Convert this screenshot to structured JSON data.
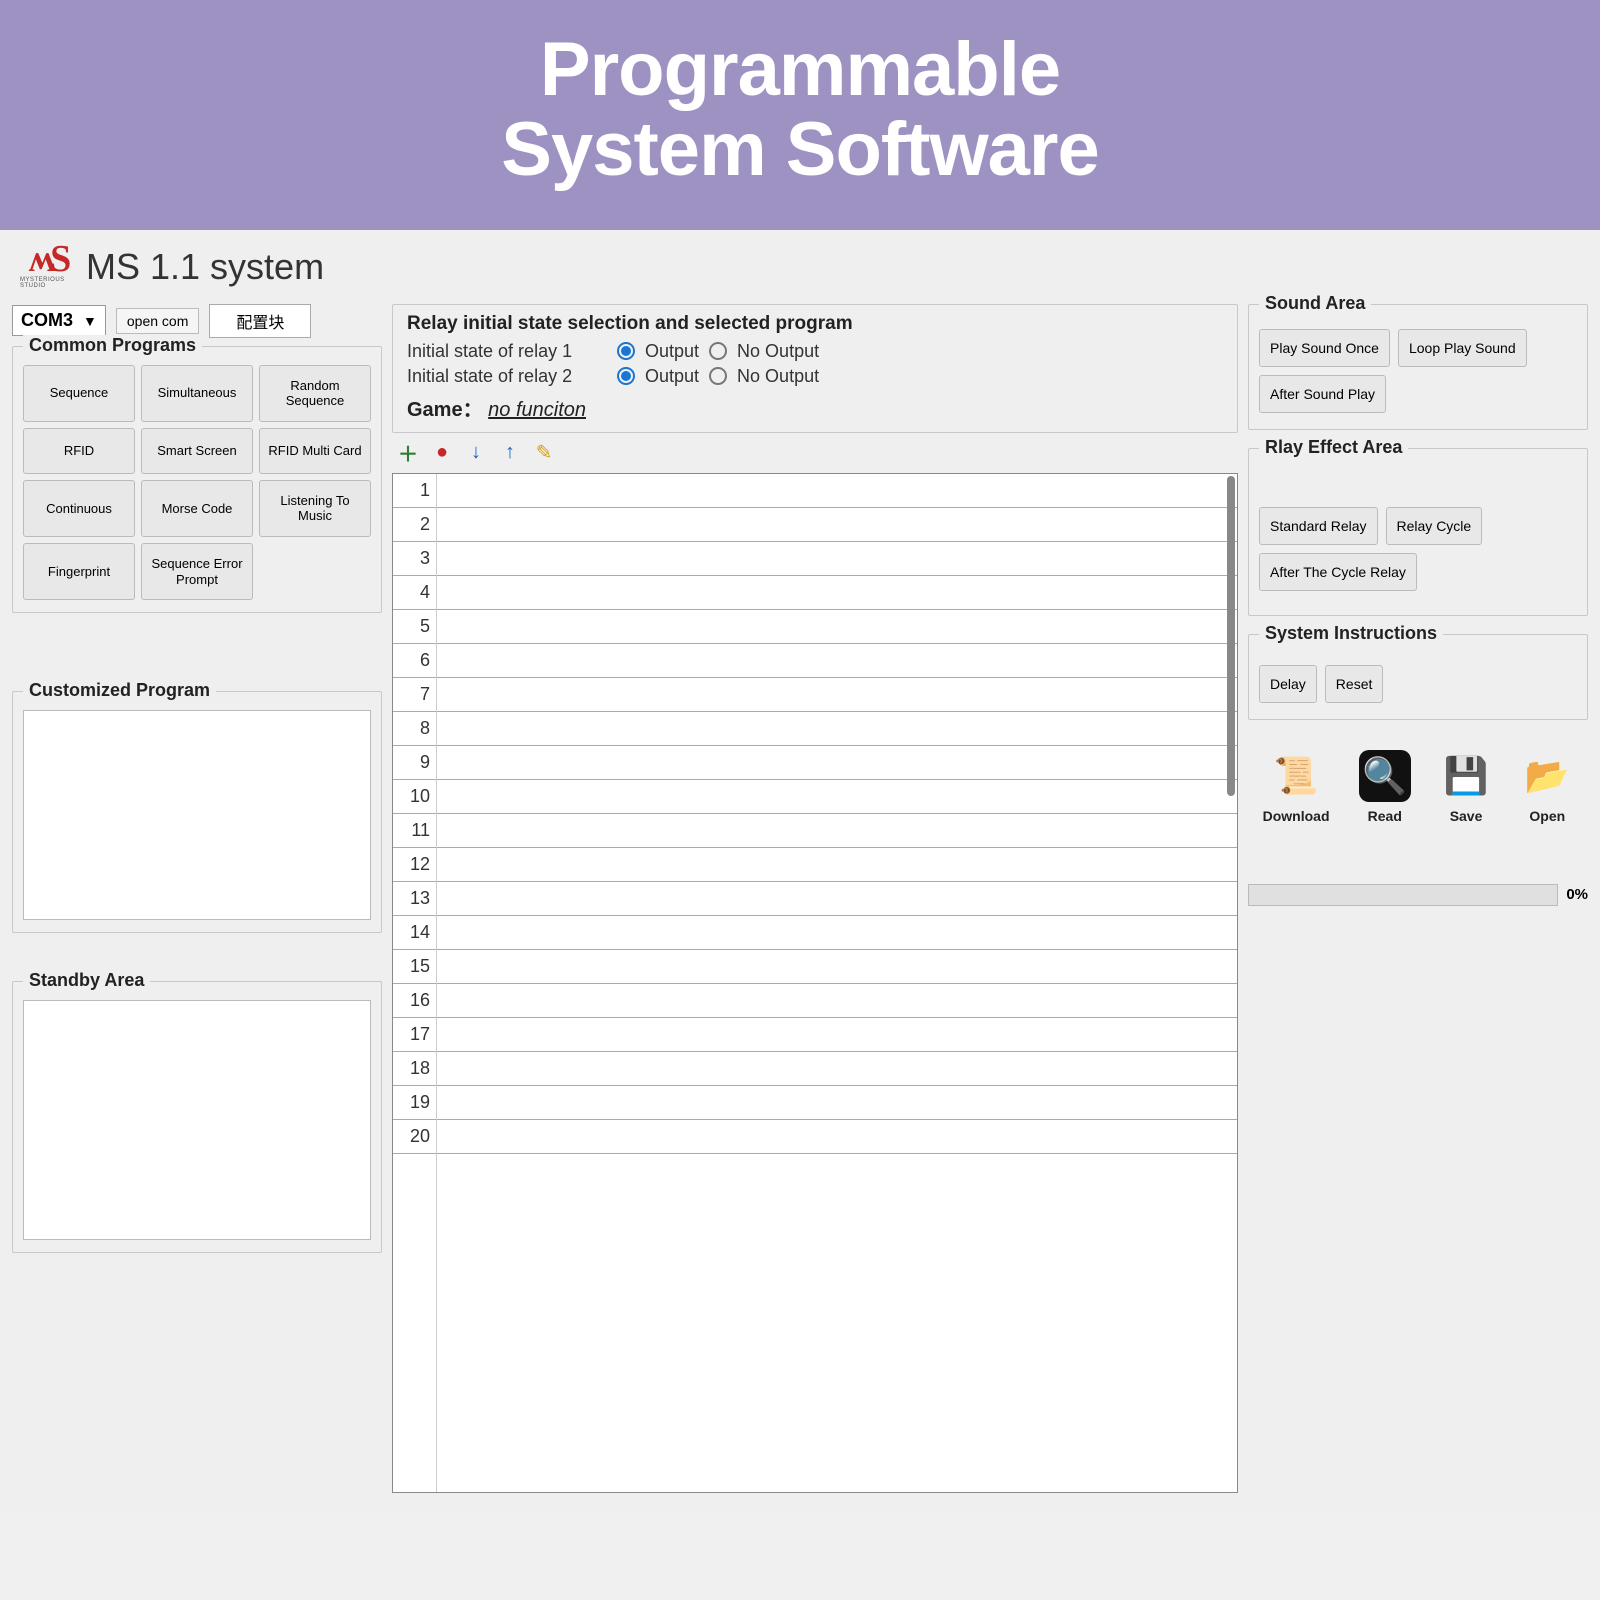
{
  "banner": {
    "line1": "Programmable",
    "line2": "System Software"
  },
  "header": {
    "logo_sub": "MYSTERIOUS STUDIO",
    "title": "MS 1.1 system"
  },
  "toprow": {
    "port": "COM3",
    "open_com": "open com",
    "cfg": "配置块"
  },
  "common_programs": {
    "title": "Common Programs",
    "items": [
      "Sequence",
      "Simultaneous",
      "Random Sequence",
      "RFID",
      "Smart Screen",
      "RFID Multi Card",
      "Continuous",
      "Morse Code",
      "Listening To Music",
      "Fingerprint",
      "Sequence Error Prompt"
    ]
  },
  "custom": {
    "title": "Customized Program"
  },
  "standby": {
    "title": "Standby Area"
  },
  "relay": {
    "title": "Relay initial state selection and selected program",
    "row1_label": "Initial state of relay 1",
    "row2_label": "Initial state of relay 2",
    "opt_output": "Output",
    "opt_no_output": "No Output",
    "game_label": "Game：",
    "game_value": "no funciton"
  },
  "grid": {
    "rows": [
      1,
      2,
      3,
      4,
      5,
      6,
      7,
      8,
      9,
      10,
      11,
      12,
      13,
      14,
      15,
      16,
      17,
      18,
      19,
      20
    ]
  },
  "sound": {
    "title": "Sound Area",
    "items": [
      "Play Sound Once",
      "Loop Play Sound",
      "After Sound Play"
    ]
  },
  "effect": {
    "title": "Rlay Effect Area",
    "items": [
      "Standard Relay",
      "Relay Cycle",
      "After The Cycle Relay"
    ]
  },
  "instr": {
    "title": "System Instructions",
    "items": [
      "Delay",
      "Reset"
    ]
  },
  "actions": {
    "download": "Download",
    "read": "Read",
    "save": "Save",
    "open": "Open"
  },
  "progress": {
    "pct": "0%"
  }
}
